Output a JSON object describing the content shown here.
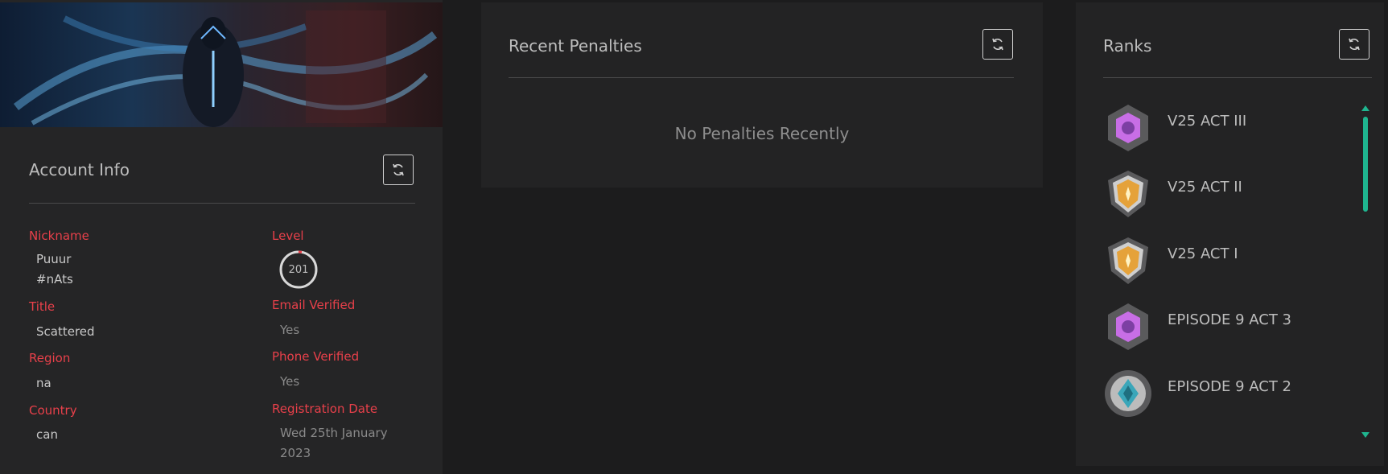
{
  "account": {
    "title": "Account Info",
    "fields": {
      "nickname_label": "Nickname",
      "nickname_line1": "Puuur",
      "nickname_line2": "#nAts",
      "level_label": "Level",
      "level_value": "201",
      "title_label": "Title",
      "title_value": "Scattered",
      "email_label": "Email Verified",
      "email_value": "Yes",
      "region_label": "Region",
      "region_value": "na",
      "phone_label": "Phone Verified",
      "phone_value": "Yes",
      "country_label": "Country",
      "country_value": "can",
      "reg_label": "Registration Date",
      "reg_line1": "Wed 25th January",
      "reg_line2": "2023"
    }
  },
  "penalties": {
    "title": "Recent Penalties",
    "empty_text": "No Penalties Recently"
  },
  "ranks": {
    "title": "Ranks",
    "items": [
      {
        "name": "V25 ACT III",
        "icon": "platinum-rank-icon",
        "color": "#c86ee6"
      },
      {
        "name": "V25 ACT II",
        "icon": "gold-rank-icon",
        "color": "#e5a23a"
      },
      {
        "name": "V25 ACT I",
        "icon": "gold-rank-icon",
        "color": "#e5a23a"
      },
      {
        "name": "EPISODE 9 ACT 3",
        "icon": "platinum-rank-icon",
        "color": "#c86ee6"
      },
      {
        "name": "EPISODE 9 ACT 2",
        "icon": "diamond-rank-icon",
        "color": "#3aa6b9"
      }
    ]
  },
  "colors": {
    "accent_red": "#e8404a",
    "scrollbar": "#1fb58f",
    "background": "#1c1c1d",
    "panel": "#232324"
  }
}
